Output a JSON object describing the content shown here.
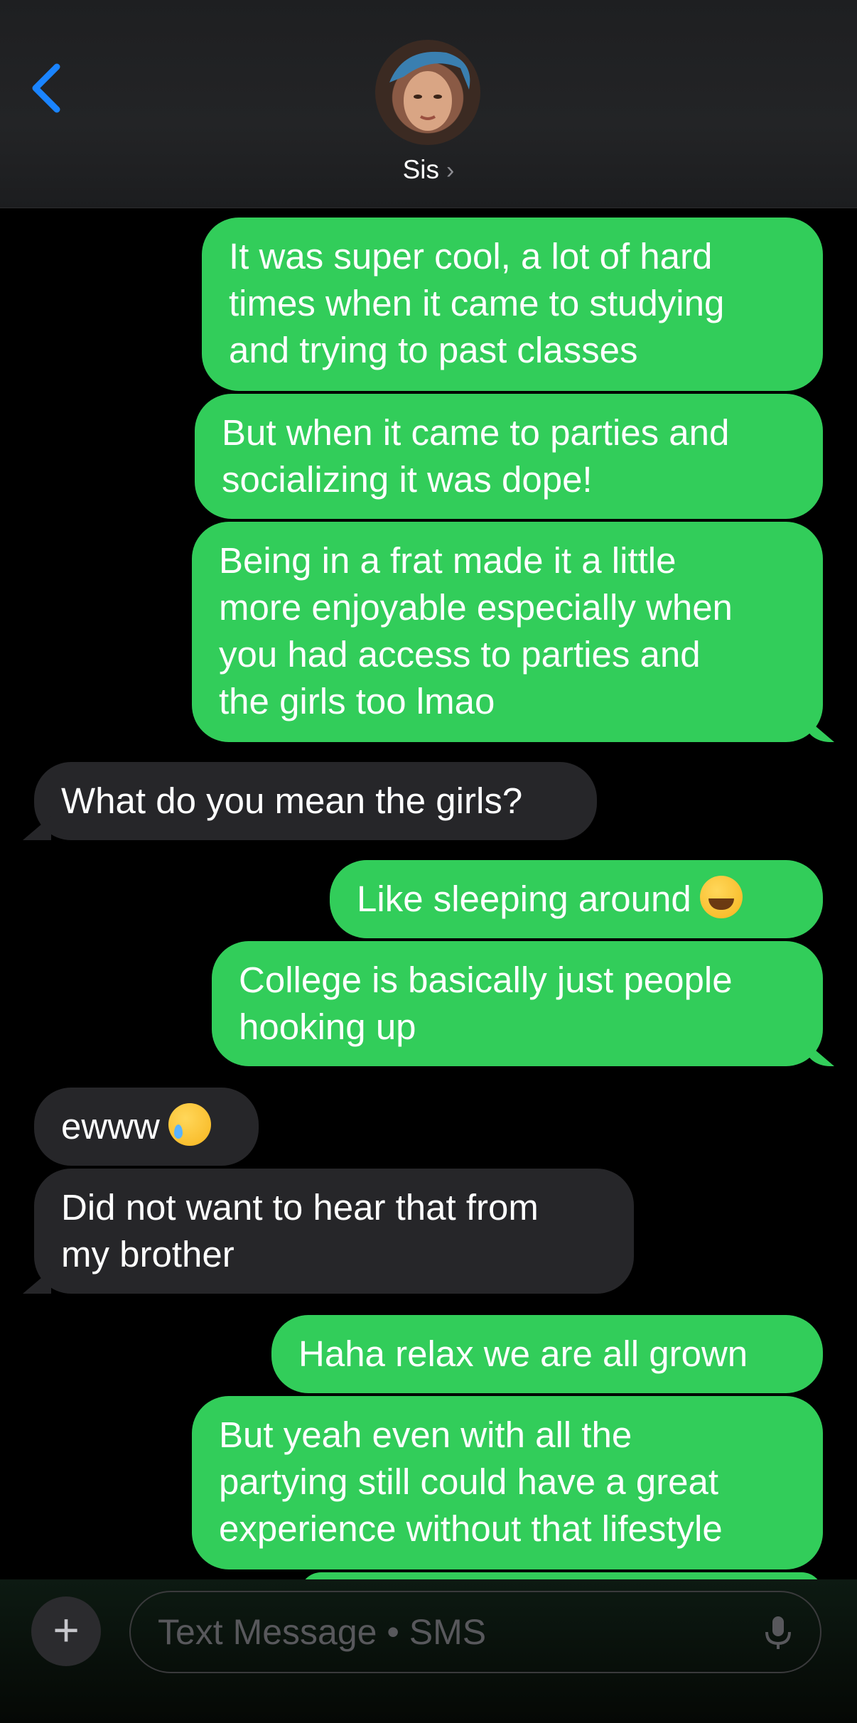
{
  "header": {
    "contact_name": "Sis",
    "chevron": "›"
  },
  "messages": [
    {
      "side": "out",
      "lines": [
        "It was super cool, a lot of hard",
        "times when it came to studying",
        "and trying to past classes"
      ]
    },
    {
      "side": "out",
      "lines": [
        "But when it came to parties and",
        "socializing it was dope!"
      ]
    },
    {
      "side": "out",
      "lines": [
        "Being in a frat made it a little",
        "more enjoyable especially when",
        "you had access to parties and",
        "the girls too lmao"
      ]
    },
    {
      "side": "in",
      "lines": [
        "What do you mean the girls?"
      ]
    },
    {
      "side": "out",
      "lines": [
        "Like sleeping around"
      ],
      "emoji": "laughing-tears"
    },
    {
      "side": "out",
      "lines": [
        "College is basically just people",
        "hooking up"
      ]
    },
    {
      "side": "in",
      "lines": [
        "ewww"
      ],
      "emoji": "crying-smile"
    },
    {
      "side": "in",
      "lines": [
        "Did not want to hear that from",
        "my brother"
      ]
    },
    {
      "side": "out",
      "lines": [
        "Haha relax we are all grown"
      ]
    },
    {
      "side": "out",
      "lines": [
        "But yeah even with all the",
        "partying still could have a great",
        "experience without that lifestyle"
      ]
    }
  ],
  "composer": {
    "placeholder": "Text Message • SMS",
    "plus_label": "+"
  },
  "colors": {
    "sms_green": "#32cd5a",
    "incoming_gray": "#262629",
    "accent_blue": "#1a84ff"
  }
}
